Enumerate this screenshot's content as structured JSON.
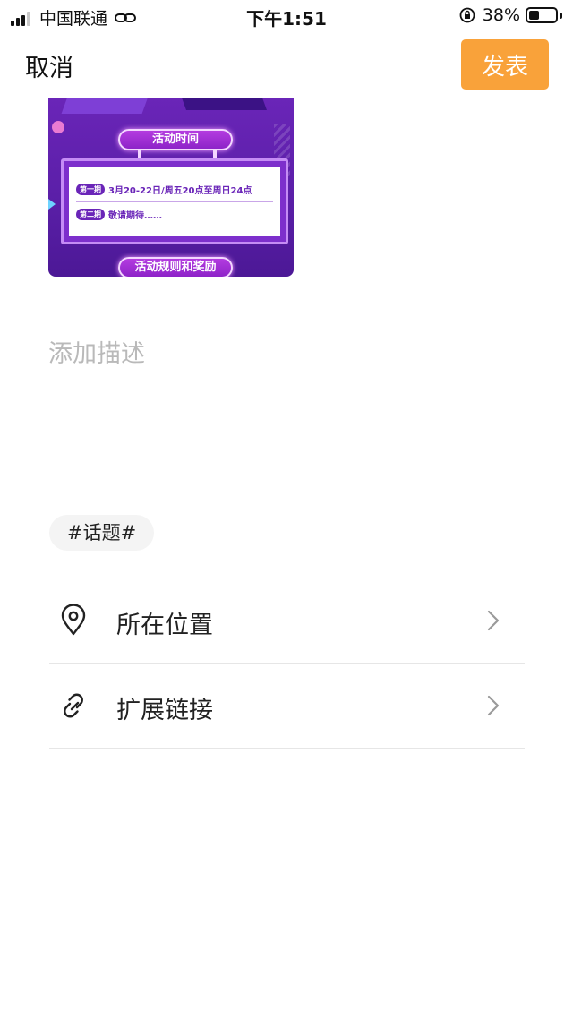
{
  "status_bar": {
    "carrier": "中国联通",
    "time": "下午1:51",
    "battery_percent": "38%",
    "battery_level": 0.38
  },
  "nav": {
    "cancel_label": "取消",
    "publish_label": "发表",
    "accent_color": "#f9a23a"
  },
  "poster": {
    "top_banner": "活动时间",
    "periods": [
      {
        "tag": "第一期",
        "text": "3月20-22日/周五20点至周日24点"
      },
      {
        "tag": "第二期",
        "text": "敬请期待……"
      }
    ],
    "bottom_banner": "活动规则和奖励"
  },
  "description": {
    "placeholder": "添加描述",
    "value": ""
  },
  "topic": {
    "label": "#话题#"
  },
  "options": [
    {
      "label": "所在位置",
      "icon": "location-pin-icon"
    },
    {
      "label": "扩展链接",
      "icon": "link-icon"
    }
  ]
}
